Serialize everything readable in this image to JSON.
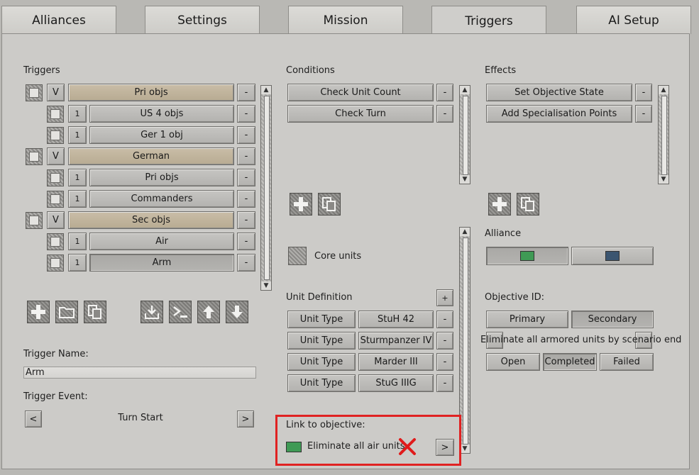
{
  "tabs": [
    "Alliances",
    "Settings",
    "Mission",
    "Triggers",
    "AI Setup"
  ],
  "triggers": {
    "heading": "Triggers",
    "items": [
      {
        "kind": "group",
        "toggle": "V",
        "label": "Pri objs"
      },
      {
        "kind": "item",
        "count": "1",
        "label": "US 4 objs"
      },
      {
        "kind": "item",
        "count": "1",
        "label": "Ger 1 obj"
      },
      {
        "kind": "group",
        "toggle": "V",
        "label": "German"
      },
      {
        "kind": "item",
        "count": "1",
        "label": "Pri objs"
      },
      {
        "kind": "item",
        "count": "1",
        "label": "Commanders"
      },
      {
        "kind": "group",
        "toggle": "V",
        "label": "Sec objs"
      },
      {
        "kind": "item",
        "count": "1",
        "label": "Air"
      },
      {
        "kind": "item",
        "count": "1",
        "label": "Arm"
      }
    ],
    "remove_label": "-"
  },
  "trigger_name": {
    "label": "Trigger Name:",
    "value": "Arm"
  },
  "trigger_event": {
    "label": "Trigger Event:",
    "value": "Turn Start",
    "prev": "<",
    "next": ">"
  },
  "conditions": {
    "heading": "Conditions",
    "items": [
      "Check Unit Count",
      "Check Turn"
    ],
    "remove_label": "-"
  },
  "effects": {
    "heading": "Effects",
    "items": [
      "Set Objective State",
      "Add Specialisation Points"
    ],
    "remove_label": "-"
  },
  "core_units": {
    "label": "Core units"
  },
  "unit_definition": {
    "heading": "Unit Definition",
    "add_label": "+",
    "rows": [
      {
        "type": "Unit Type",
        "value": "StuH 42"
      },
      {
        "type": "Unit Type",
        "value": "Sturmpanzer IV"
      },
      {
        "type": "Unit Type",
        "value": "Marder III"
      },
      {
        "type": "Unit Type",
        "value": "StuG IIIG"
      }
    ],
    "remove_label": "-"
  },
  "link_objective": {
    "label": "Link to objective:",
    "value": "Eliminate all air units",
    "next": ">",
    "swatch_color": "#3f9a55",
    "x_color": "#e01b1b"
  },
  "alliance": {
    "label": "Alliance",
    "colors": [
      "#3f9a55",
      "#3b5570"
    ]
  },
  "objective": {
    "label": "Objective ID:",
    "types": [
      "Primary",
      "Secondary"
    ],
    "selected_type": "Secondary",
    "text": "Eliminate all armored units by scenario end",
    "states": [
      "Open",
      "Completed",
      "Failed"
    ],
    "selected_state": "Completed"
  }
}
